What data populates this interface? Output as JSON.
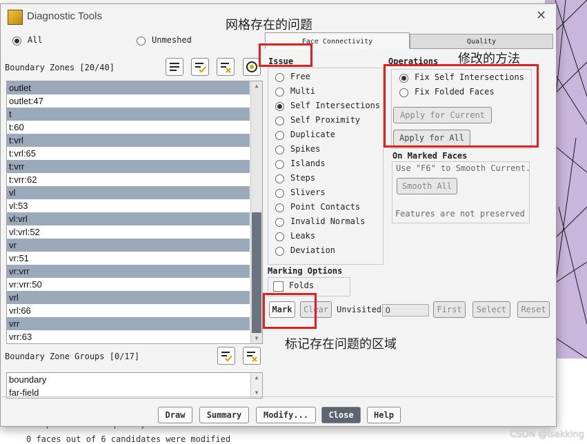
{
  "window": {
    "title": "Diagnostic Tools"
  },
  "filter": {
    "all_label": "All",
    "unmeshed_label": "Unmeshed",
    "selected": "All"
  },
  "boundary_zones": {
    "header": "Boundary Zones [20/40]",
    "items": [
      {
        "label": "outlet",
        "selected": true
      },
      {
        "label": "outlet:47",
        "selected": false
      },
      {
        "label": "t",
        "selected": true
      },
      {
        "label": "t:60",
        "selected": false
      },
      {
        "label": "t:vrl",
        "selected": true
      },
      {
        "label": "t:vrl:65",
        "selected": false
      },
      {
        "label": "t:vrr",
        "selected": true
      },
      {
        "label": "t:vrr:62",
        "selected": false
      },
      {
        "label": "vl",
        "selected": true
      },
      {
        "label": "vl:53",
        "selected": false
      },
      {
        "label": "vl:vrl",
        "selected": true
      },
      {
        "label": "vl:vrl:52",
        "selected": false
      },
      {
        "label": "vr",
        "selected": true
      },
      {
        "label": "vr:51",
        "selected": false
      },
      {
        "label": "vr:vrr",
        "selected": true
      },
      {
        "label": "vr:vrr:50",
        "selected": false
      },
      {
        "label": "vrl",
        "selected": true
      },
      {
        "label": "vrl:66",
        "selected": false
      },
      {
        "label": "vrr",
        "selected": true
      },
      {
        "label": "vrr:63",
        "selected": false
      }
    ]
  },
  "zone_groups": {
    "header": "Boundary Zone Groups [0/17]",
    "items": [
      "boundary",
      "far-field"
    ]
  },
  "tabs": [
    {
      "label": "Face Connectivity",
      "active": true
    },
    {
      "label": "Quality",
      "active": false
    }
  ],
  "issue": {
    "header": "Issue",
    "selected": "Self Intersections",
    "items": [
      "Free",
      "Multi",
      "Self Intersections",
      "Self Proximity",
      "Duplicate",
      "Spikes",
      "Islands",
      "Steps",
      "Slivers",
      "Point Contacts",
      "Invalid Normals",
      "Leaks",
      "Deviation"
    ]
  },
  "operations": {
    "header": "Operations",
    "options": [
      "Fix Self Intersections",
      "Fix Folded Faces"
    ],
    "selected": "Fix Self Intersections",
    "apply_current": "Apply for Current",
    "apply_all": "Apply for All"
  },
  "marked_faces": {
    "header": "On Marked Faces",
    "hint": "Use \"F6\" to Smooth Current.",
    "smooth_all": "Smooth All",
    "note": "Features are not preserved"
  },
  "marking_options": {
    "header": "Marking Options",
    "folds_label": "Folds"
  },
  "marking_row": {
    "mark": "Mark",
    "clear": "Clear",
    "unvisited_label": "Unvisited",
    "unvisited_value": "0",
    "first": "First",
    "select": "Select",
    "reset": "Reset"
  },
  "footer": {
    "draw": "Draw",
    "summary": "Summary",
    "modify": "Modify...",
    "close": "Close",
    "help": "Help"
  },
  "annotations": {
    "mesh_problem": "网格存在的问题",
    "fix_method": "修改的方法",
    "mark_region": "标记存在问题的区域"
  },
  "console": {
    "line1": "The present mesh quality   ordered",
    "line2": "0 faces out of 6 candidates were modified"
  },
  "watermark": "CSDN @isakking",
  "colors": {
    "selection": "#9aaabb",
    "annotation_red": "#e02020",
    "close_button": "#5c6670",
    "mesh_bg": "#c9b6dc"
  }
}
